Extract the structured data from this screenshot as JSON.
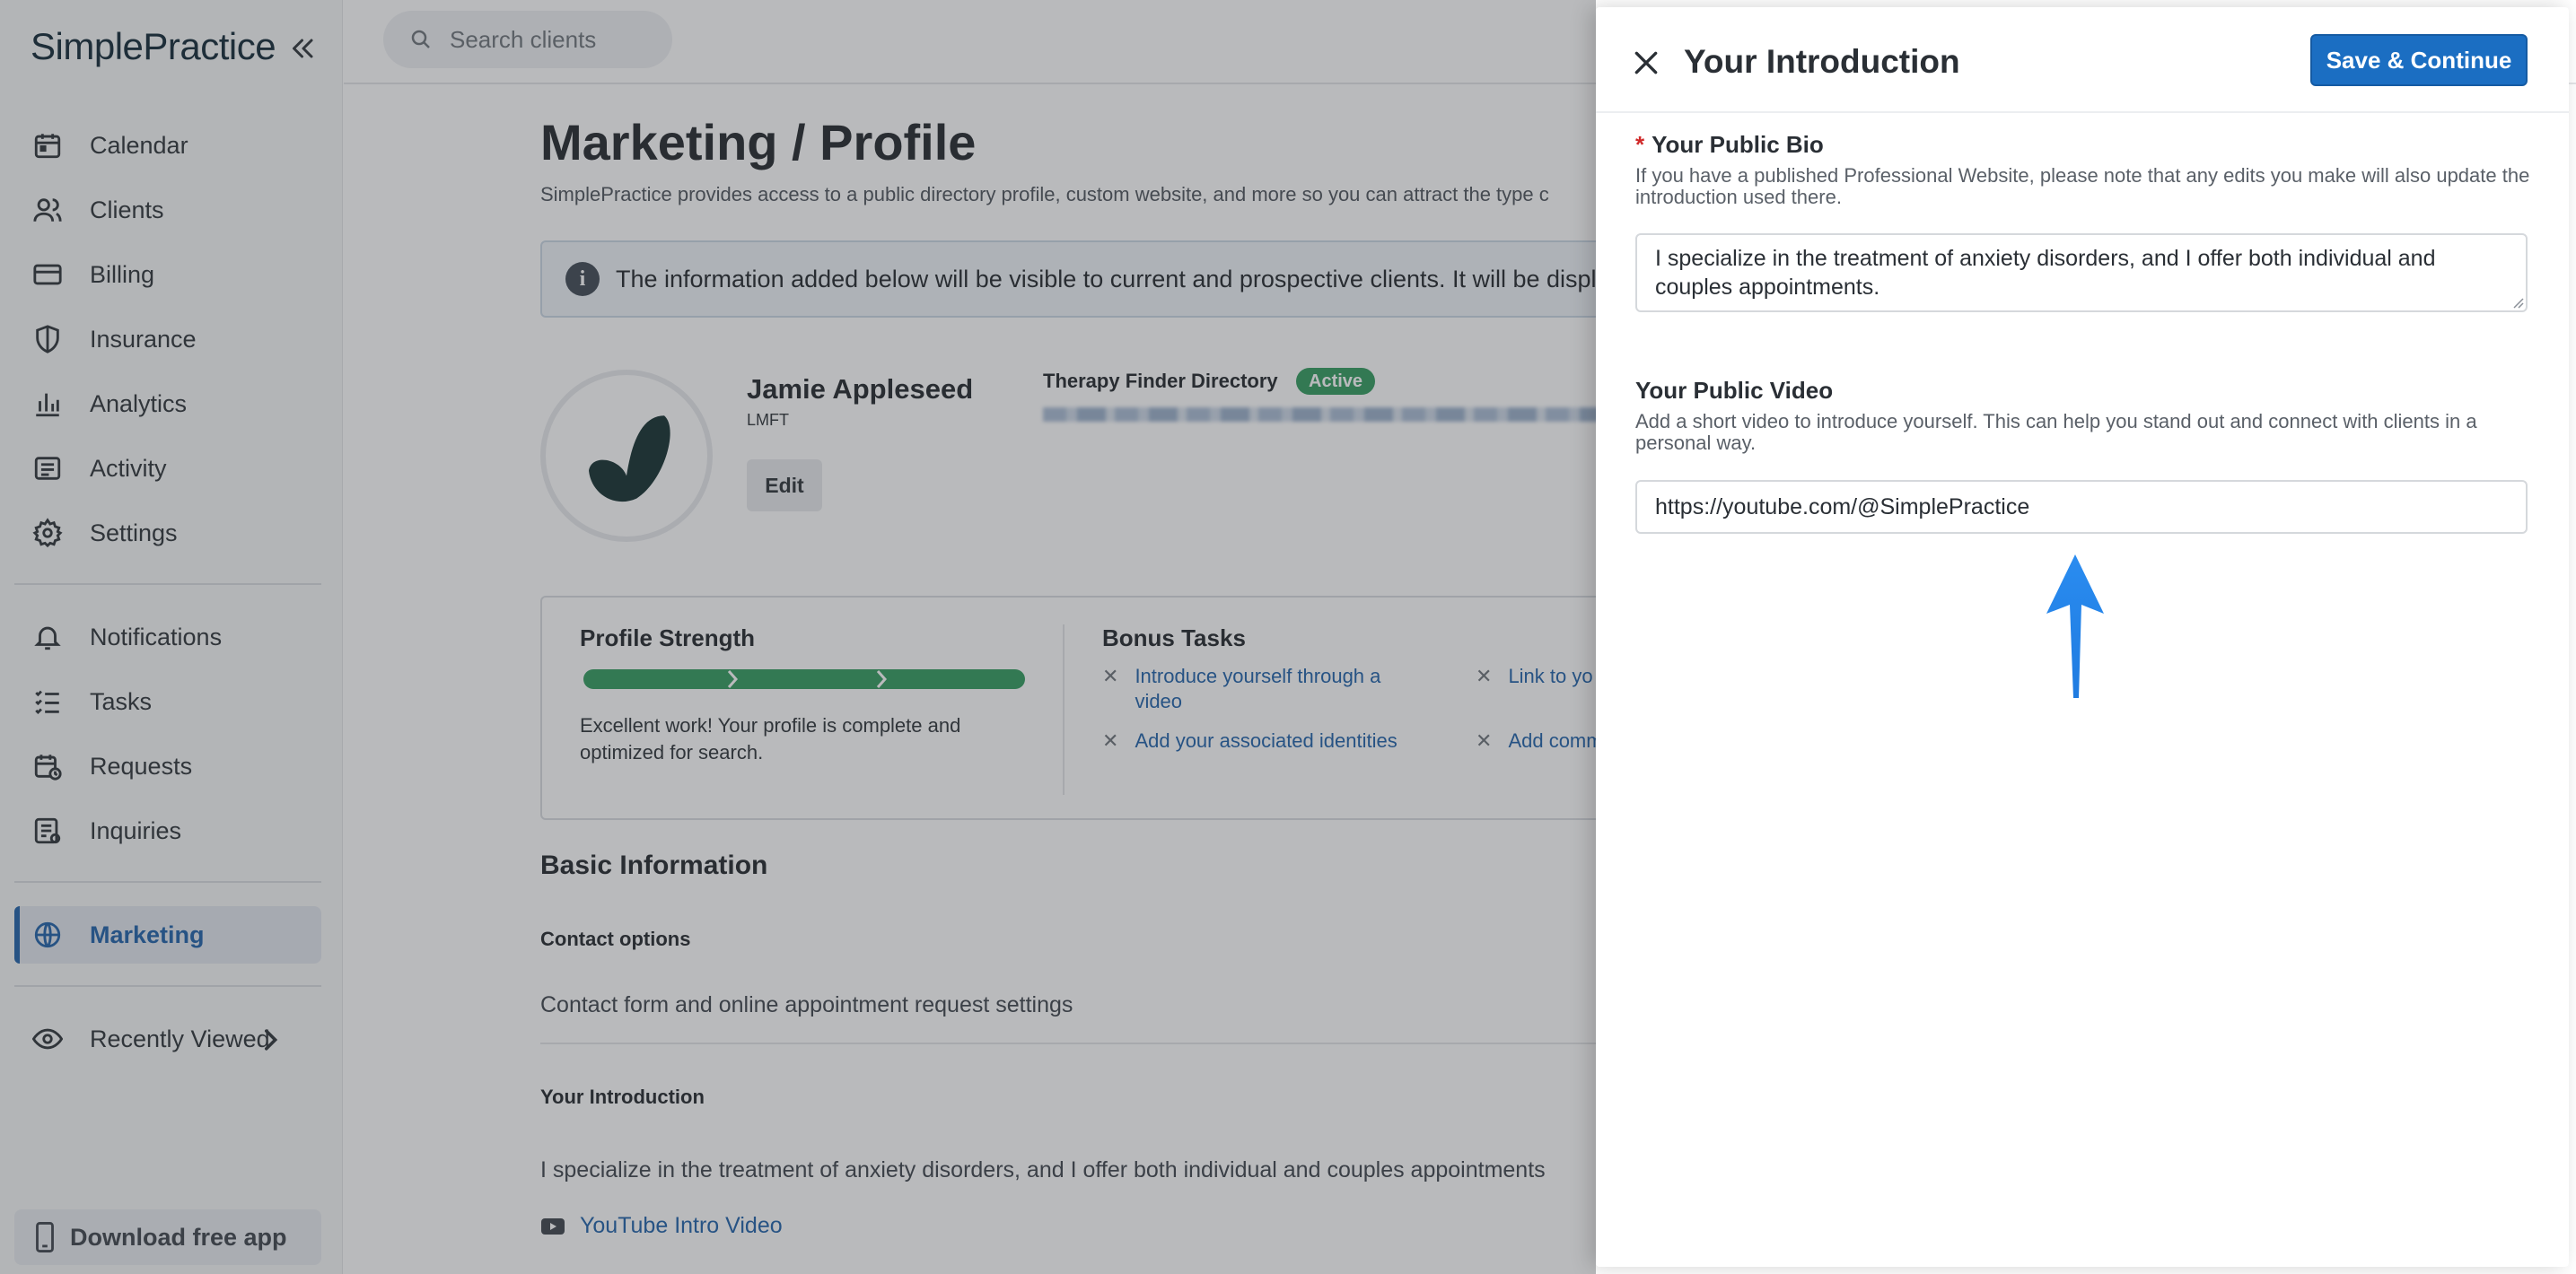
{
  "app": {
    "logo_text": "SimplePractice"
  },
  "sidebar": {
    "items": [
      {
        "label": "Calendar",
        "icon": "calendar-icon"
      },
      {
        "label": "Clients",
        "icon": "clients-icon"
      },
      {
        "label": "Billing",
        "icon": "billing-card-icon"
      },
      {
        "label": "Insurance",
        "icon": "shield-icon"
      },
      {
        "label": "Analytics",
        "icon": "bar-chart-icon"
      },
      {
        "label": "Activity",
        "icon": "list-icon"
      },
      {
        "label": "Settings",
        "icon": "gear-icon"
      }
    ],
    "items2": [
      {
        "label": "Notifications",
        "icon": "bell-icon"
      },
      {
        "label": "Tasks",
        "icon": "checklist-icon"
      },
      {
        "label": "Requests",
        "icon": "calendar-request-icon"
      },
      {
        "label": "Inquiries",
        "icon": "inquiry-icon"
      }
    ],
    "marketing_label": "Marketing",
    "recently_viewed_label": "Recently Viewed",
    "download_label": "Download free app",
    "active_color": "#1b5fa8"
  },
  "topbar": {
    "search_placeholder": "Search clients"
  },
  "page": {
    "title": "Marketing / Profile",
    "subtitle": "SimplePractice provides access to a public directory profile, custom website, and more so you can attract the type c",
    "banner_text": "The information added below will be visible to current and prospective clients. It will be display",
    "provider_name": "Jamie Appleseed",
    "provider_credential": "LMFT",
    "edit_label": "Edit",
    "directory_label": "Therapy Finder Directory",
    "directory_status": "Active",
    "profile_strength": {
      "title": "Profile Strength",
      "progress": 1.0,
      "message": "Excellent work! Your profile is complete and optimized for search."
    },
    "bonus_tasks": {
      "title": "Bonus Tasks",
      "items": [
        "Introduce yourself through a video",
        "Add your associated identities",
        "Link to yo",
        "Add comm"
      ]
    },
    "basic_info_title": "Basic Information",
    "contact_options_heading": "Contact options",
    "contact_options_text": "Contact form and online appointment request settings",
    "your_intro_heading": "Your Introduction",
    "your_intro_text": "I specialize in the treatment of anxiety disorders, and I offer both individual and couples appointments",
    "video_link_label": "YouTube Intro Video"
  },
  "drawer": {
    "title": "Your Introduction",
    "save_label": "Save & Continue",
    "bio_label": "Your Public Bio",
    "bio_help": "If you have a published Professional Website, please note that any edits you make will also update the introduction used there.",
    "bio_value": "I specialize in the treatment of anxiety disorders, and I offer both individual and couples appointments.",
    "video_label": "Your Public Video",
    "video_help": "Add a short video to introduce yourself. This can help you stand out and connect with clients in a personal way.",
    "video_value": "https://youtube.com/@SimplePractice",
    "accent_color": "#1b6ec2",
    "annotation_arrow_color": "#2a8cf0"
  }
}
